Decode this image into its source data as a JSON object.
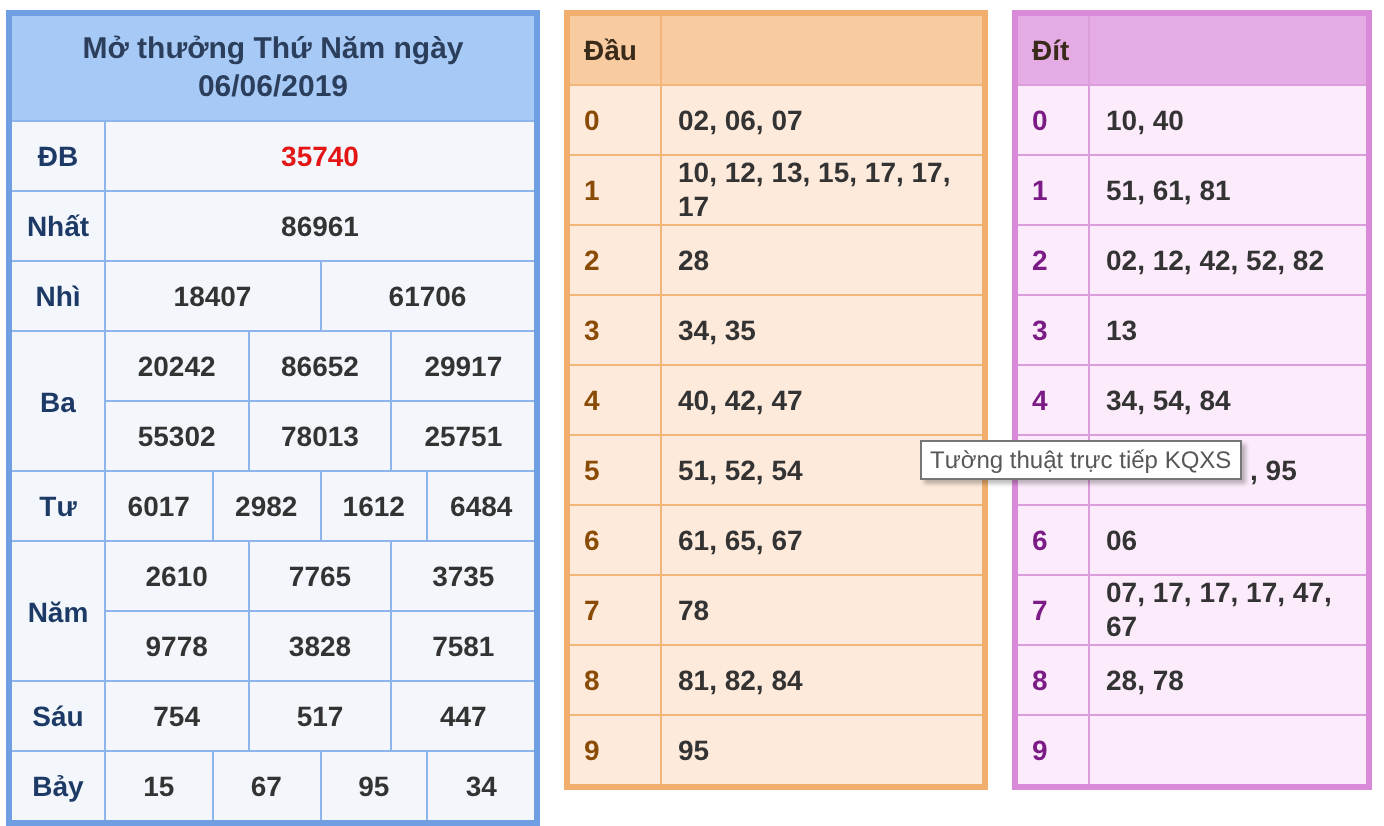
{
  "results": {
    "title_lines": [
      "Mở thưởng Thứ Năm ngày",
      "06/06/2019"
    ],
    "prizes": [
      {
        "name": "ĐB",
        "kind": "special",
        "lines": [
          [
            "35740"
          ]
        ]
      },
      {
        "name": "Nhất",
        "kind": "normal",
        "lines": [
          [
            "86961"
          ]
        ]
      },
      {
        "name": "Nhì",
        "kind": "normal",
        "lines": [
          [
            "18407",
            "61706"
          ]
        ]
      },
      {
        "name": "Ba",
        "kind": "normal",
        "lines": [
          [
            "20242",
            "86652",
            "29917"
          ],
          [
            "55302",
            "78013",
            "25751"
          ]
        ]
      },
      {
        "name": "Tư",
        "kind": "normal",
        "lines": [
          [
            "6017",
            "2982",
            "1612",
            "6484"
          ]
        ]
      },
      {
        "name": "Năm",
        "kind": "normal",
        "lines": [
          [
            "2610",
            "7765",
            "3735"
          ],
          [
            "9778",
            "3828",
            "7581"
          ]
        ]
      },
      {
        "name": "Sáu",
        "kind": "normal",
        "lines": [
          [
            "754",
            "517",
            "447"
          ]
        ]
      },
      {
        "name": "Bảy",
        "kind": "normal",
        "lines": [
          [
            "15",
            "67",
            "95",
            "34"
          ]
        ]
      }
    ]
  },
  "loto_tables": [
    {
      "kind": "head",
      "heading": "Đầu",
      "rows": [
        {
          "digit": "0",
          "numbers": "02, 06, 07"
        },
        {
          "digit": "1",
          "numbers": "10, 12, 13, 15, 17, 17, 17"
        },
        {
          "digit": "2",
          "numbers": "28"
        },
        {
          "digit": "3",
          "numbers": "34, 35"
        },
        {
          "digit": "4",
          "numbers": "40, 42, 47"
        },
        {
          "digit": "5",
          "numbers": "51, 52, 54"
        },
        {
          "digit": "6",
          "numbers": "61, 65, 67"
        },
        {
          "digit": "7",
          "numbers": "78"
        },
        {
          "digit": "8",
          "numbers": "81, 82, 84"
        },
        {
          "digit": "9",
          "numbers": "95"
        }
      ]
    },
    {
      "kind": "tail",
      "heading": "Đít",
      "rows": [
        {
          "digit": "0",
          "numbers": "10, 40"
        },
        {
          "digit": "1",
          "numbers": "51, 61, 81"
        },
        {
          "digit": "2",
          "numbers": "02, 12, 42, 52, 82"
        },
        {
          "digit": "3",
          "numbers": "13"
        },
        {
          "digit": "4",
          "numbers": "34, 54, 84"
        },
        {
          "numbers": ", 95"
        },
        {
          "digit": "6",
          "numbers": "06"
        },
        {
          "digit": "7",
          "numbers": "07, 17, 17, 17, 47, 67"
        },
        {
          "digit": "8",
          "numbers": "28, 78"
        },
        {
          "digit": "9"
        }
      ]
    }
  ],
  "tooltip": {
    "text": "Tường thuật trực tiếp KQXS"
  }
}
